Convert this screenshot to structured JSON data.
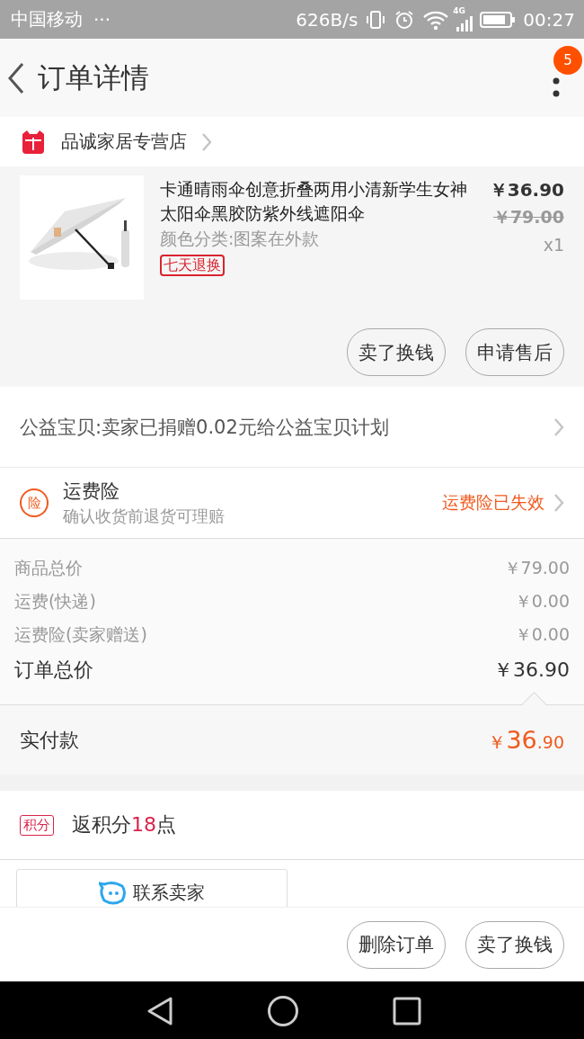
{
  "status_bar": {
    "carrier": "中国移动",
    "more": "···",
    "speed": "626B/s",
    "network": "4G",
    "time": "00:27"
  },
  "header": {
    "title": "订单详情",
    "badge": "5"
  },
  "shop": {
    "name": "品诚家居专营店"
  },
  "product": {
    "title": "卡通晴雨伞创意折叠两用小清新学生女神太阳伞黑胶防紫外线遮阳伞",
    "variant": "颜色分类:图案在外款",
    "tag": "七天退换",
    "price": "￥36.90",
    "original_price": "￥79.00",
    "quantity": "x1",
    "buttons": [
      "卖了换钱",
      "申请售后"
    ]
  },
  "charity": {
    "text": "公益宝贝:卖家已捐赠0.02元给公益宝贝计划"
  },
  "insurance": {
    "icon": "险",
    "title": "运费险",
    "subtitle": "确认收货前退货可理赔",
    "status": "运费险已失效"
  },
  "summary": [
    {
      "kind": "minor",
      "label": "商品总价",
      "value": "￥79.00"
    },
    {
      "kind": "minor",
      "label": "运费(快递)",
      "value": "￥0.00"
    },
    {
      "kind": "minor",
      "label": "运费险(卖家赠送)",
      "value": "￥0.00"
    },
    {
      "kind": "total",
      "label": "订单总价",
      "value": "￥36.90"
    }
  ],
  "paid": {
    "label": "实付款",
    "currency": "￥",
    "whole": "36",
    "cents": ".90"
  },
  "points": {
    "badge": "积分",
    "before": "返积分",
    "number": "18",
    "after": "点"
  },
  "contact": {
    "label": "联系卖家"
  },
  "actions": [
    "删除订单",
    "卖了换钱"
  ]
}
